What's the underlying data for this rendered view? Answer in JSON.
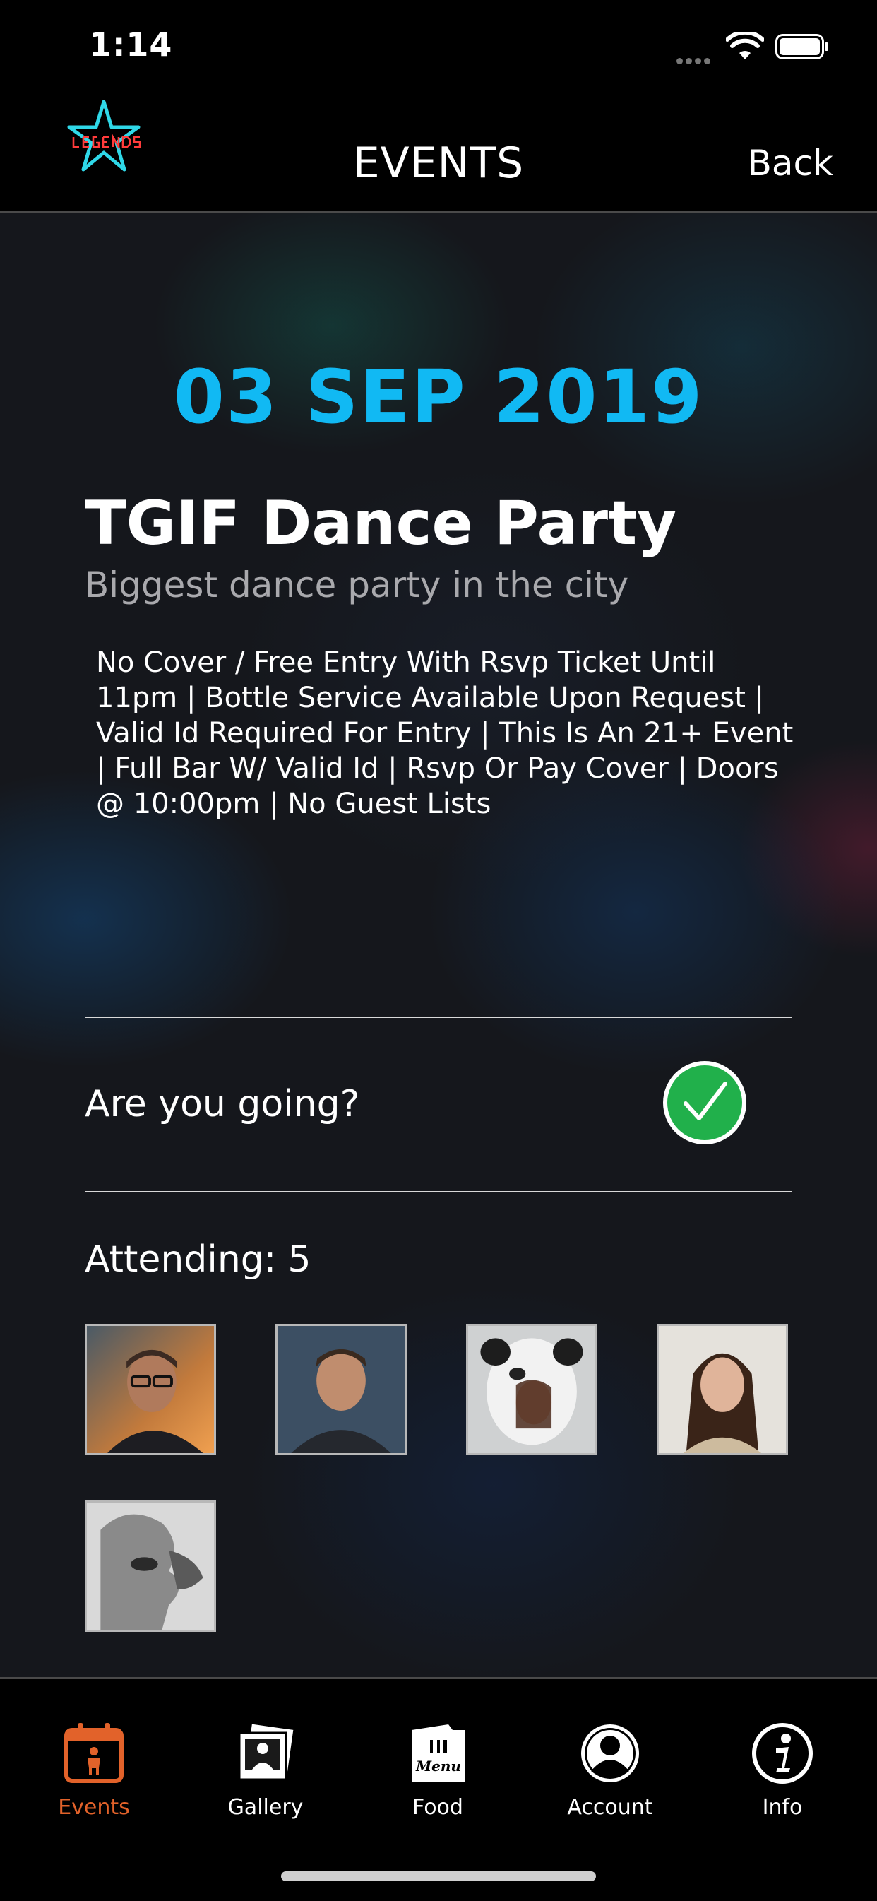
{
  "status_bar": {
    "time": "1:14"
  },
  "nav": {
    "title": "EVENTS",
    "back_label": "Back"
  },
  "event": {
    "date": "03 SEP 2019",
    "title": "TGIF Dance Party",
    "subtitle": "Biggest dance party in the city",
    "description": "No Cover / Free Entry With Rsvp Ticket Until 11pm | Bottle Service Available Upon Request | Valid Id Required For Entry | This Is An 21+ Event | Full Bar W/ Valid Id | Rsvp Or Pay Cover | Doors @ 10:00pm | No Guest Lists"
  },
  "rsvp": {
    "question": "Are you going?",
    "going": true
  },
  "attending": {
    "label": "Attending:",
    "count": "5",
    "avatars": [
      "attendee-1",
      "attendee-2",
      "attendee-3",
      "attendee-4",
      "attendee-5"
    ]
  },
  "tabs": [
    {
      "label": "Events",
      "icon": "calendar-icon",
      "active": true
    },
    {
      "label": "Gallery",
      "icon": "photos-icon",
      "active": false
    },
    {
      "label": "Food",
      "icon": "menu-icon",
      "active": false
    },
    {
      "label": "Account",
      "icon": "account-icon",
      "active": false
    },
    {
      "label": "Info",
      "icon": "info-icon",
      "active": false
    }
  ],
  "colors": {
    "accent": "#11b9f3",
    "active_tab": "#e2622a",
    "check": "#21b04b"
  }
}
